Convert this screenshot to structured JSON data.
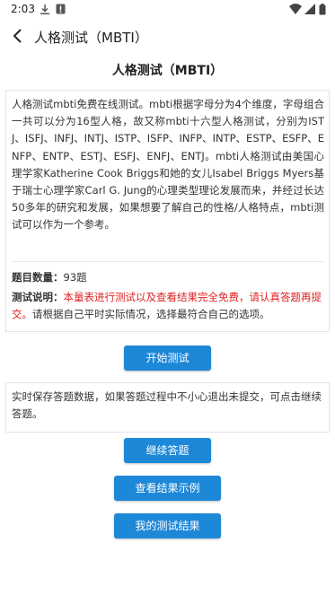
{
  "status_bar": {
    "time": "2:03"
  },
  "app_bar": {
    "title": "人格测试（MBTI）"
  },
  "page": {
    "title": "人格测试（MBTI）"
  },
  "intro": {
    "text": "人格测试mbti免费在线测试。mbti根据字母分为4个维度，字母组合一共可以分为16型人格，故又称mbti十六型人格测试，分别为ISTJ、ISFJ、INFJ、INTJ、ISTP、ISFP、INFP、INTP、ESTP、ESFP、ENFP、ENTP、ESTJ、ESFJ、ENFJ、ENTJ。mbti人格测试由美国心理学家Katherine Cook Briggs和她的女儿Isabel Briggs Myers基于瑞士心理学家Carl G. Jung的心理类型理论发展而来，并经过长达50多年的研究和发展，如果想要了解自己的性格/人格特点，mbti测试可以作为一个参考。"
  },
  "question_count": {
    "label": "题目数量：",
    "value": "93题"
  },
  "test_description": {
    "label": "测试说明：",
    "highlight": "本量表进行测试以及查看结果完全免费，请认真答题再提交。",
    "rest": "请根据自己平时实际情况，选择最符合自己的选项。"
  },
  "buttons": {
    "start": "开始测试",
    "continue": "继续答题",
    "example": "查看结果示例",
    "my_results": "我的测试结果"
  },
  "save_notice": {
    "text": "实时保存答题数据，如果答题过程中不小心退出未提交，可点击继续答题。"
  },
  "icons": {
    "download": "download-icon",
    "alert": "alert-icon",
    "wifi": "wifi-icon",
    "signal": "signal-icon",
    "battery": "battery-icon",
    "back": "back-arrow-icon"
  },
  "colors": {
    "accent": "#1e88d8",
    "warning": "#e02020"
  }
}
